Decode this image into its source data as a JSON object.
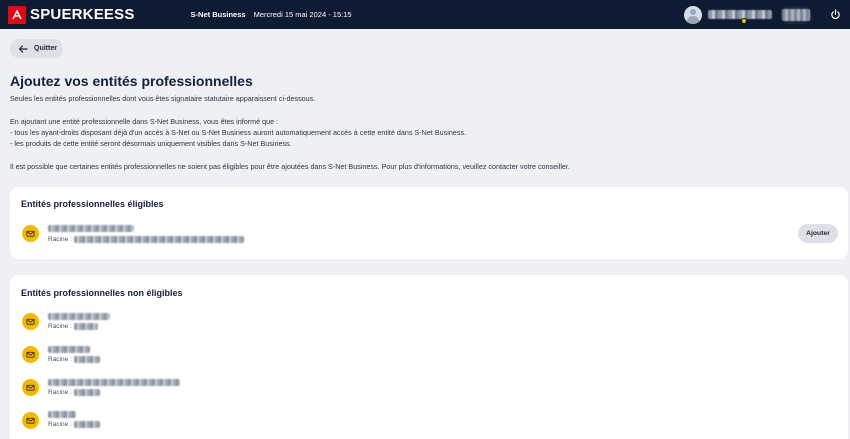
{
  "app": {
    "logo_text": "SPUERKEESS",
    "context_title": "S-Net Business",
    "datetime": "Mercredi 15 mai 2024 - 15:15"
  },
  "nav": {
    "quit_label": "Quitter"
  },
  "intro": {
    "title": "Ajoutez vos entités professionnelles",
    "line1": "Seules les entités professionnelles dont vous êtes signataire statutaire apparaissent ci-dessous.",
    "line2": "En ajoutant une entité professionnelle dans S-Net Business, vous êtes informé que :",
    "line3": "- tous les ayant-droits disposant déjà d'un accès à S-Net ou S-Net Business auront automatiquement accès à cette entité dans S-Net Business.",
    "line4": "- les produits de cette entité seront désormais uniquement visibles dans S-Net Business.",
    "line5": "Il est possible que certaines entités professionnelles ne soient pas éligibles pour être ajoutées dans S-Net Business. Pour plus d'informations, veuillez contacter votre conseiller."
  },
  "eligible": {
    "title": "Entités professionnelles éligibles",
    "items": [
      {
        "racine_label": "Racine :",
        "action_label": "Ajouter"
      }
    ]
  },
  "non_eligible": {
    "title": "Entités professionnelles non éligibles",
    "items": [
      {
        "racine_label": "Racine :"
      },
      {
        "racine_label": "Racine :"
      },
      {
        "racine_label": "Racine :"
      },
      {
        "racine_label": "Racine :"
      }
    ]
  },
  "colors": {
    "topbar": "#0f1b33",
    "brand_red": "#e30613",
    "entity_icon": "#f5b800",
    "background": "#eef0f3"
  },
  "icons": {
    "logo": "spuerkeess-logo-icon",
    "back": "arrow-left-icon",
    "entity": "envelope-icon",
    "power": "power-icon",
    "avatar": "user-avatar-icon"
  }
}
